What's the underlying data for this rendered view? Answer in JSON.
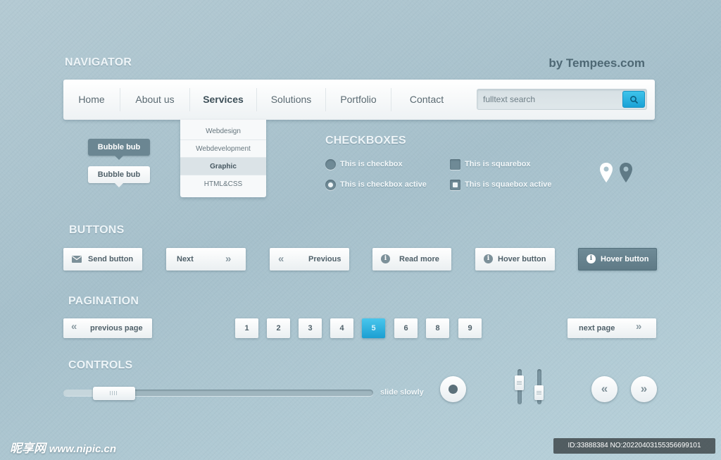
{
  "header": {
    "title": "NAVIGATOR",
    "brand": "by Tempees.com"
  },
  "nav": {
    "items": [
      {
        "label": "Home"
      },
      {
        "label": "About us"
      },
      {
        "label": "Services"
      },
      {
        "label": "Solutions"
      },
      {
        "label": "Portfolio"
      },
      {
        "label": "Contact"
      }
    ],
    "active_item": "Services",
    "search": {
      "placeholder": "fulltext search",
      "value": ""
    }
  },
  "dropdown": {
    "items": [
      {
        "label": "Webdesign"
      },
      {
        "label": "Webdevelopment"
      },
      {
        "label": "Graphic"
      },
      {
        "label": "HTML&CSS"
      }
    ],
    "active_item": "Graphic"
  },
  "bubbles": {
    "dark": "Bubble bub",
    "light": "Bubble bub"
  },
  "checkboxes": {
    "title": "CHECKBOXES",
    "items": [
      {
        "label": "This is checkbox",
        "type": "round",
        "checked": false
      },
      {
        "label": "This is checkbox active",
        "type": "round",
        "checked": true
      },
      {
        "label": "This is squarebox",
        "type": "square",
        "checked": false
      },
      {
        "label": "This is squaebox active",
        "type": "square",
        "checked": true
      }
    ]
  },
  "buttons": {
    "title": "BUTTONS",
    "items": [
      {
        "label": "Send button",
        "icon": "envelope-icon"
      },
      {
        "label": "Next",
        "icon": "double-chevron-right-icon"
      },
      {
        "label": "Previous",
        "icon": "double-chevron-left-icon"
      },
      {
        "label": "Read more",
        "icon": "info-icon"
      },
      {
        "label": "Hover button",
        "icon": "info-icon"
      },
      {
        "label": "Hover button",
        "icon": "info-icon",
        "state": "hover"
      }
    ]
  },
  "pagination": {
    "title": "PAGINATION",
    "previous_label": "previous page",
    "next_label": "next page",
    "pages": [
      "1",
      "2",
      "3",
      "4",
      "5",
      "6",
      "8",
      "9"
    ],
    "current_page": "5"
  },
  "controls": {
    "title": "CONTROLS",
    "slider": {
      "label": "slide slowly",
      "value": 0.1
    },
    "vertical_sliders": [
      {
        "value": 0.7
      },
      {
        "value": 0.2
      }
    ]
  },
  "watermark": {
    "left_cn": "昵享网",
    "left_url": "www.nipic.cn",
    "right_id": "ID:33888384 NO:20220403155356699101"
  },
  "colors": {
    "background": "#a9c2cc",
    "accent": "#1ea3d6",
    "dark_button": "#648090",
    "text": "#4f6069"
  }
}
